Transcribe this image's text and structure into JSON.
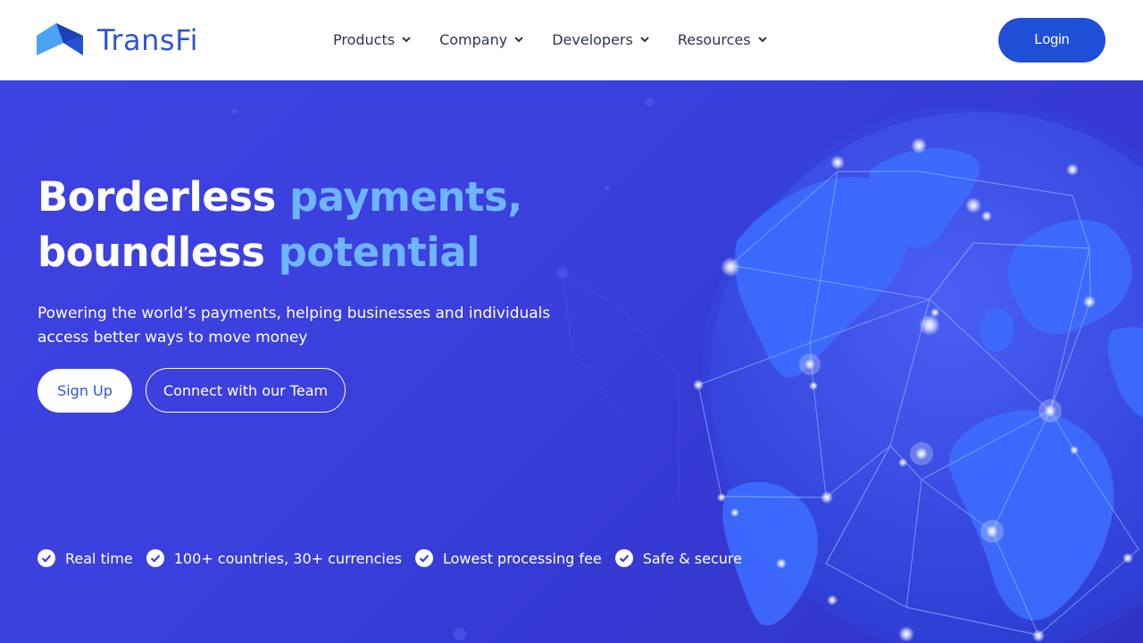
{
  "brand": {
    "name": "TransFi",
    "color": "#2f55d4"
  },
  "nav": {
    "items": [
      {
        "label": "Products",
        "icon": "chevron-down-icon"
      },
      {
        "label": "Company",
        "icon": "chevron-down-icon"
      },
      {
        "label": "Developers",
        "icon": "chevron-down-icon"
      },
      {
        "label": "Resources",
        "icon": "chevron-down-icon"
      }
    ],
    "login_label": "Login"
  },
  "hero": {
    "headline_line1_plain": "Borderless ",
    "headline_line1_accent": "payments,",
    "headline_line2_plain": "boundless ",
    "headline_line2_accent": "potential",
    "subtitle": "Powering the world’s payments, helping businesses and individuals access better ways to move money",
    "signup_label": "Sign Up",
    "connect_label": "Connect with our Team",
    "features": [
      {
        "label": "Real time",
        "icon": "check-circle-icon"
      },
      {
        "label": "100+ countries, 30+ currencies",
        "icon": "check-circle-icon"
      },
      {
        "label": "Lowest processing fee",
        "icon": "check-circle-icon"
      },
      {
        "label": "Safe & secure",
        "icon": "check-circle-icon"
      }
    ]
  },
  "colors": {
    "primary_button": "#1f4fd7",
    "hero_background": "#3b3fdd",
    "headline_accent": "#6eb5ff"
  }
}
